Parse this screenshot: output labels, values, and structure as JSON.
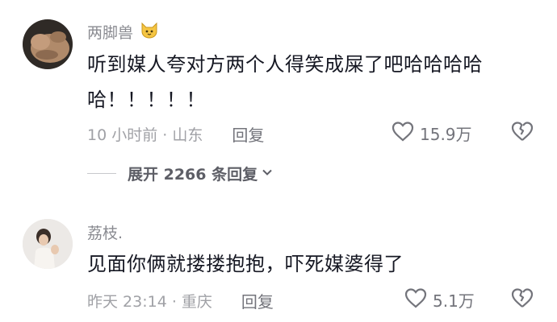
{
  "comments": [
    {
      "username": "两脚兽",
      "badge_icon": "cat-emoji-icon",
      "text_line1": "听到媒人夸对方两个人得笑成屎了吧哈哈哈哈",
      "text_line2": "哈！！！！！",
      "meta": "10 小时前 · 山东",
      "reply_label": "回复",
      "likes": "15.9万",
      "expand_label": "展开 2266 条回复"
    },
    {
      "username": "荔枝.",
      "text": "见面你俩就搂搂抱抱，吓死媒婆得了",
      "meta": "昨天 23:14 · 重庆",
      "reply_label": "回复",
      "likes": "5.1万"
    }
  ],
  "icons": {
    "like": "heart-outline-icon",
    "dislike": "broken-heart-icon",
    "expand": "chevron-down-icon"
  },
  "colors": {
    "text_primary": "#161823",
    "text_secondary": "#8a8b91",
    "icon": "#73747b"
  }
}
